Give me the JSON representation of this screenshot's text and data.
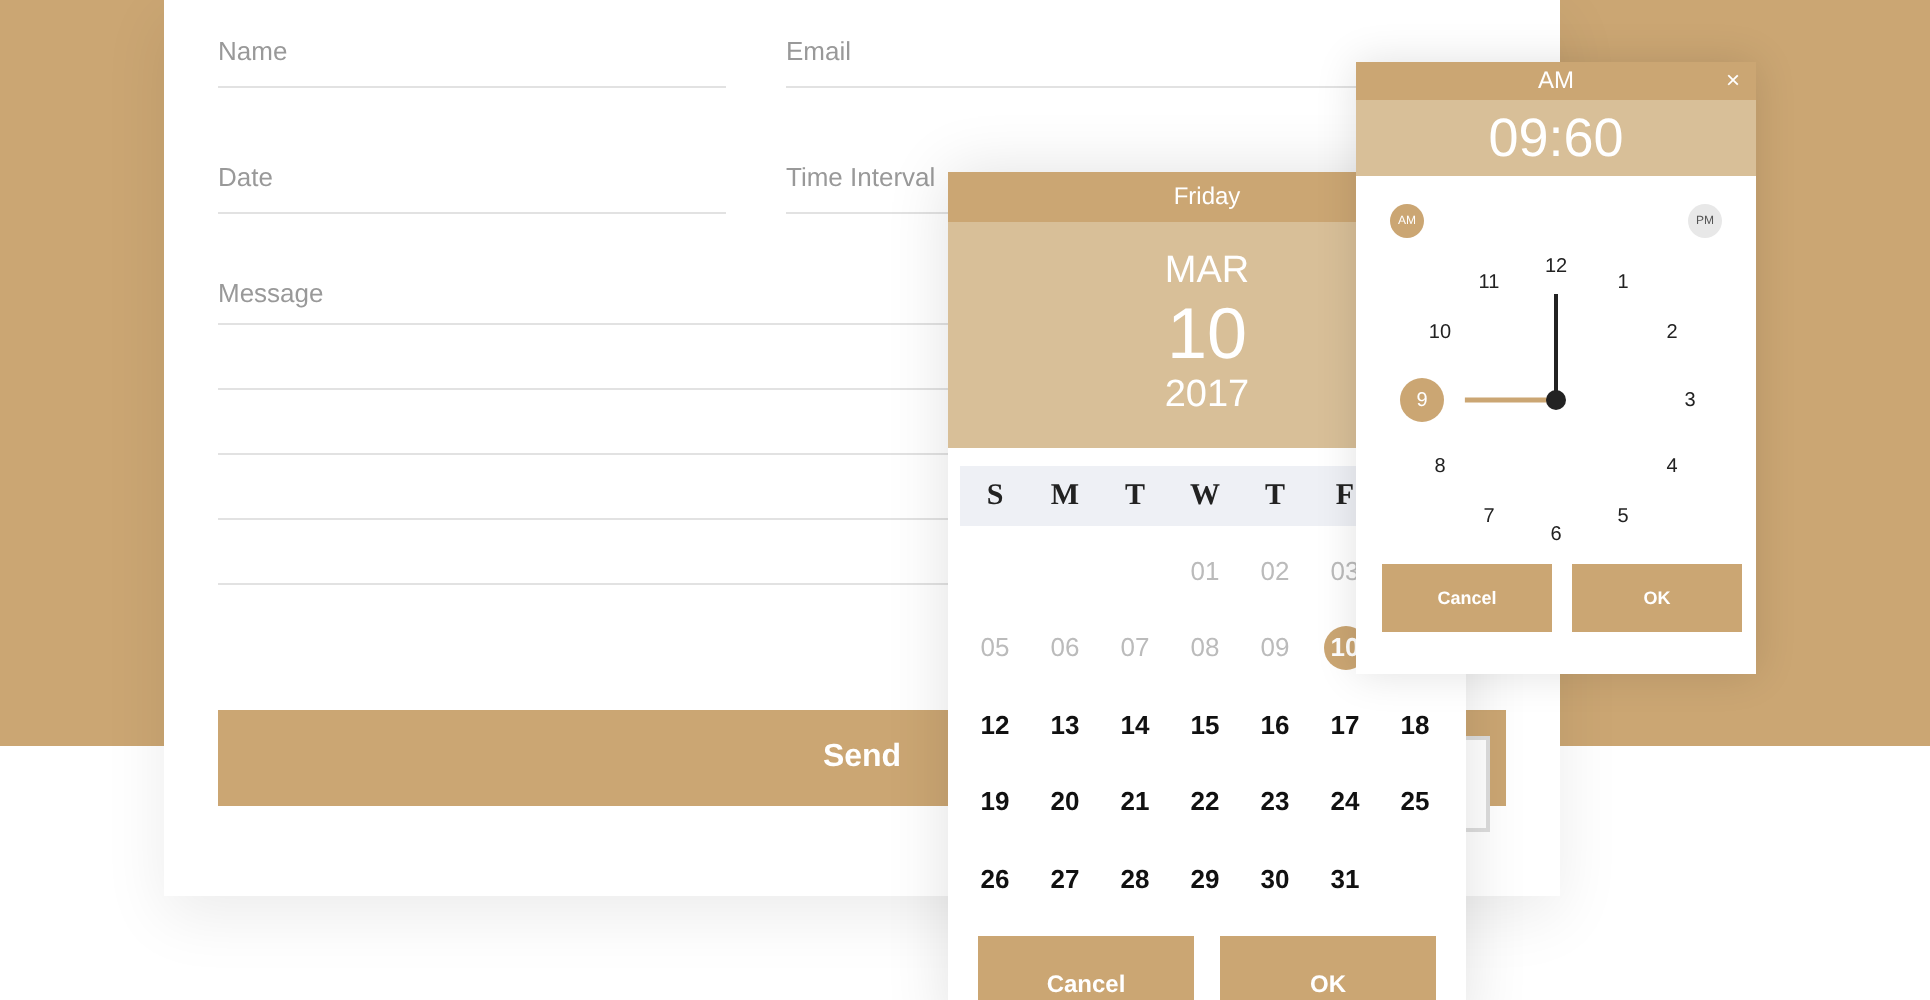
{
  "form": {
    "fields": [
      {
        "placeholder": "Name"
      },
      {
        "placeholder": "Email"
      },
      {
        "placeholder": "Date"
      },
      {
        "placeholder": "Time Interval"
      }
    ],
    "message": {
      "placeholder": "Message"
    },
    "send_button": "Send"
  },
  "date_picker": {
    "weekday": "Friday",
    "month": "MAR",
    "day": "10",
    "year": "2017",
    "weekday_headers": [
      "S",
      "M",
      "T",
      "W",
      "T",
      "F"
    ],
    "weeks": [
      [
        {
          "kind": "empty"
        },
        {
          "kind": "empty"
        },
        {
          "kind": "empty"
        },
        {
          "kind": "day",
          "label": "01",
          "disabled": true,
          "selected": false
        },
        {
          "kind": "day",
          "label": "02",
          "disabled": true,
          "selected": false
        },
        {
          "kind": "day",
          "label": "03",
          "disabled": true,
          "selected": false
        }
      ],
      [
        {
          "kind": "day",
          "label": "05",
          "disabled": true,
          "selected": false
        },
        {
          "kind": "day",
          "label": "06",
          "disabled": true,
          "selected": false
        },
        {
          "kind": "day",
          "label": "07",
          "disabled": true,
          "selected": false
        },
        {
          "kind": "day",
          "label": "08",
          "disabled": true,
          "selected": false
        },
        {
          "kind": "day",
          "label": "09",
          "disabled": true,
          "selected": false
        },
        {
          "kind": "day",
          "label": "10",
          "disabled": false,
          "selected": true
        }
      ],
      [
        {
          "kind": "day",
          "label": "12",
          "disabled": false,
          "selected": false
        },
        {
          "kind": "day",
          "label": "13",
          "disabled": false,
          "selected": false
        },
        {
          "kind": "day",
          "label": "14",
          "disabled": false,
          "selected": false
        },
        {
          "kind": "day",
          "label": "15",
          "disabled": false,
          "selected": false
        },
        {
          "kind": "day",
          "label": "16",
          "disabled": false,
          "selected": false
        },
        {
          "kind": "day",
          "label": "17",
          "disabled": false,
          "selected": false
        },
        {
          "kind": "day",
          "label": "18",
          "disabled": false,
          "selected": false
        }
      ],
      [
        {
          "kind": "day",
          "label": "19",
          "disabled": false,
          "selected": false
        },
        {
          "kind": "day",
          "label": "20",
          "disabled": false,
          "selected": false
        },
        {
          "kind": "day",
          "label": "21",
          "disabled": false,
          "selected": false
        },
        {
          "kind": "day",
          "label": "22",
          "disabled": false,
          "selected": false
        },
        {
          "kind": "day",
          "label": "23",
          "disabled": false,
          "selected": false
        },
        {
          "kind": "day",
          "label": "24",
          "disabled": false,
          "selected": false
        },
        {
          "kind": "day",
          "label": "25",
          "disabled": false,
          "selected": false
        }
      ],
      [
        {
          "kind": "day",
          "label": "26",
          "disabled": false,
          "selected": false
        },
        {
          "kind": "day",
          "label": "27",
          "disabled": false,
          "selected": false
        },
        {
          "kind": "day",
          "label": "28",
          "disabled": false,
          "selected": false
        },
        {
          "kind": "day",
          "label": "29",
          "disabled": false,
          "selected": false
        },
        {
          "kind": "day",
          "label": "30",
          "disabled": false,
          "selected": false
        },
        {
          "kind": "day",
          "label": "31",
          "disabled": false,
          "selected": false
        }
      ]
    ],
    "buttons": [
      "Cancel",
      "OK"
    ]
  },
  "time_picker": {
    "title": "AM",
    "close": "×",
    "time": "09:60",
    "periods": [
      {
        "label": "AM",
        "selected": true
      },
      {
        "label": "PM",
        "selected": false
      }
    ],
    "hours": [
      {
        "label": "12",
        "selected": false
      },
      {
        "label": "1",
        "selected": false
      },
      {
        "label": "2",
        "selected": false
      },
      {
        "label": "3",
        "selected": false
      },
      {
        "label": "4",
        "selected": false
      },
      {
        "label": "5",
        "selected": false
      },
      {
        "label": "6",
        "selected": false
      },
      {
        "label": "7",
        "selected": false
      },
      {
        "label": "8",
        "selected": false
      },
      {
        "label": "9",
        "selected": true
      },
      {
        "label": "10",
        "selected": false
      },
      {
        "label": "11",
        "selected": false
      }
    ],
    "buttons": [
      "Cancel",
      "OK"
    ]
  }
}
